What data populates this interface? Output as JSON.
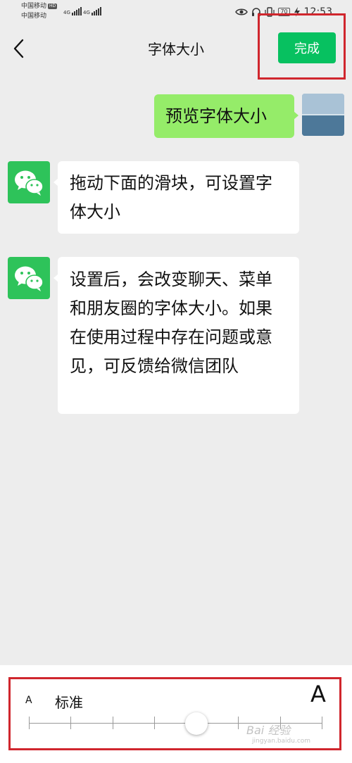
{
  "status_bar": {
    "carrier_1": "中国移动",
    "hd_badge": "HD",
    "carrier_2": "中国移动",
    "signal_1_label": "4G",
    "signal_2_label": "4G",
    "battery": "70",
    "time": "12:53",
    "icons": [
      "eye-icon",
      "headphones-icon",
      "vibrate-icon",
      "battery-icon",
      "charging-icon"
    ]
  },
  "nav": {
    "title": "字体大小",
    "done_label": "完成",
    "back_icon": "chevron-left-icon"
  },
  "chat": {
    "preview_message": "预览字体大小",
    "message_1": "拖动下面的滑块，可设置字体大小",
    "message_2": "设置后，会改变聊天、菜单和朋友圈的字体大小。如果在使用过程中存在问题或意见，可反馈给微信团队"
  },
  "font_slider": {
    "small_label": "A",
    "current_label": "标准",
    "large_label": "A",
    "steps": 8,
    "selected_step": 4
  },
  "watermark": {
    "brand": "Bai 经验",
    "url": "jingyan.baidu.com"
  },
  "colors": {
    "accent": "#07c160",
    "my_bubble": "#95ec69",
    "background": "#ededed",
    "highlight": "#d0262d"
  }
}
